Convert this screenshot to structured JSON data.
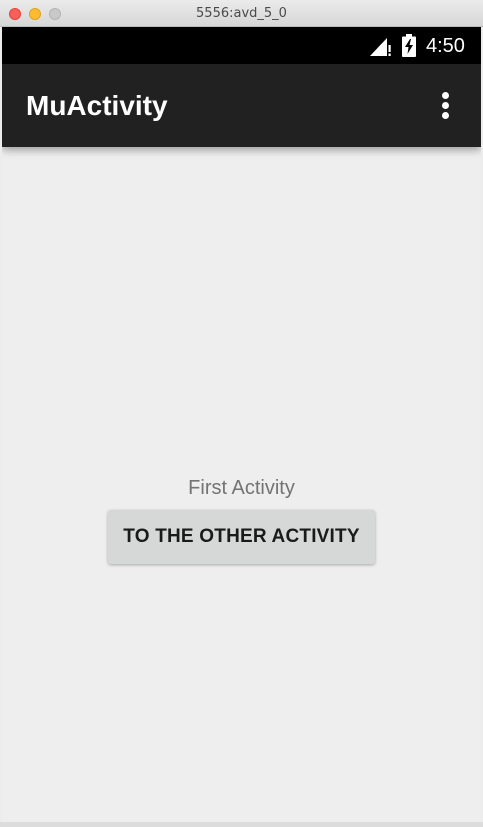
{
  "window": {
    "title": "5556:avd_5_0"
  },
  "status_bar": {
    "time": "4:50",
    "signal_icon": "cell-signal-no-data-icon",
    "battery_icon": "battery-charging-icon"
  },
  "app_bar": {
    "title": "MuActivity",
    "overflow_icon": "overflow-menu-icon"
  },
  "main": {
    "label": "First Activity",
    "button_label": "TO THE OTHER ACTIVITY"
  },
  "colors": {
    "app_bar": "#212121",
    "status_bar": "#000000",
    "background": "#eeeeee",
    "button": "#d6d7d7"
  }
}
